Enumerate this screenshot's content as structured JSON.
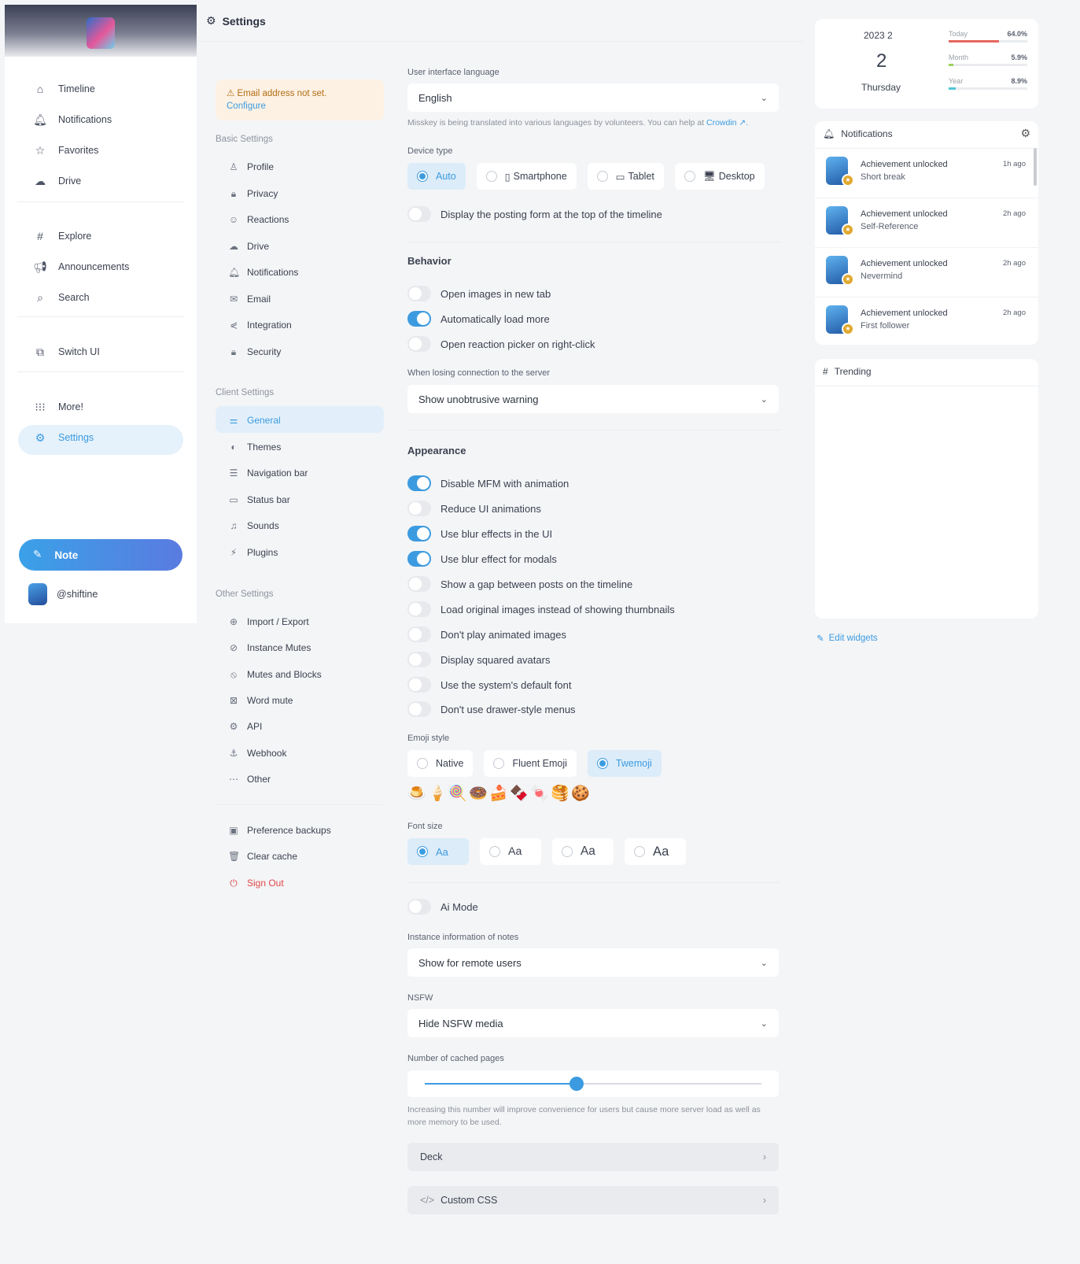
{
  "nav": {
    "items": [
      {
        "label": "Timeline",
        "icon": "home-icon",
        "glyph": "⌂"
      },
      {
        "label": "Notifications",
        "icon": "bell-icon",
        "glyph": "🔔︎"
      },
      {
        "label": "Favorites",
        "icon": "star-icon",
        "glyph": "☆"
      },
      {
        "label": "Drive",
        "icon": "cloud-icon",
        "glyph": "☁"
      },
      {
        "label": "Explore",
        "icon": "hash-icon",
        "glyph": "#"
      },
      {
        "label": "Announcements",
        "icon": "megaphone-icon",
        "glyph": "📢︎"
      },
      {
        "label": "Search",
        "icon": "search-icon",
        "glyph": "⌕"
      },
      {
        "label": "Switch UI",
        "icon": "switch-icon",
        "glyph": "⧉"
      },
      {
        "label": "More!",
        "icon": "grid-icon",
        "glyph": "⁝⁝⁝"
      },
      {
        "label": "Settings",
        "icon": "gear-icon",
        "glyph": "⚙"
      }
    ],
    "note_label": "Note",
    "account": "@shiftine"
  },
  "header": {
    "title": "Settings"
  },
  "menu": {
    "warning_text": "Email address not set.",
    "warning_link": "Configure",
    "basic_title": "Basic Settings",
    "basic": [
      "Profile",
      "Privacy",
      "Reactions",
      "Drive",
      "Notifications",
      "Email",
      "Integration",
      "Security"
    ],
    "client_title": "Client Settings",
    "client": [
      "General",
      "Themes",
      "Navigation bar",
      "Status bar",
      "Sounds",
      "Plugins"
    ],
    "other_title": "Other Settings",
    "other": [
      "Import / Export",
      "Instance Mutes",
      "Mutes and Blocks",
      "Word mute",
      "API",
      "Webhook",
      "Other"
    ],
    "extra": [
      "Preference backups",
      "Clear cache",
      "Sign Out"
    ]
  },
  "main": {
    "lang_label": "User interface language",
    "lang_value": "English",
    "lang_hint": "Misskey is being translated into various languages by volunteers. You can help at ",
    "lang_hint_link": "Crowdin",
    "device_label": "Device type",
    "device_options": [
      "Auto",
      "Smartphone",
      "Tablet",
      "Desktop"
    ],
    "device_selected": "Auto",
    "posting_form": "Display the posting form at the top of the timeline",
    "posting_form_on": false,
    "behavior_title": "Behavior",
    "behavior": [
      {
        "label": "Open images in new tab",
        "on": false
      },
      {
        "label": "Automatically load more",
        "on": true
      },
      {
        "label": "Open reaction picker on right-click",
        "on": false
      }
    ],
    "conn_label": "When losing connection to the server",
    "conn_value": "Show unobtrusive warning",
    "appearance_title": "Appearance",
    "appearance": [
      {
        "label": "Disable MFM with animation",
        "on": true
      },
      {
        "label": "Reduce UI animations",
        "on": false
      },
      {
        "label": "Use blur effects in the UI",
        "on": true
      },
      {
        "label": "Use blur effect for modals",
        "on": true
      },
      {
        "label": "Show a gap between posts on the timeline",
        "on": false
      },
      {
        "label": "Load original images instead of showing thumbnails",
        "on": false
      },
      {
        "label": "Don't play animated images",
        "on": false
      },
      {
        "label": "Display squared avatars",
        "on": false
      },
      {
        "label": "Use the system's default font",
        "on": false
      },
      {
        "label": "Don't use drawer-style menus",
        "on": false
      }
    ],
    "emoji_label": "Emoji style",
    "emoji_options": [
      "Native",
      "Fluent Emoji",
      "Twemoji"
    ],
    "emoji_selected": "Twemoji",
    "emoji_preview": [
      "🍮",
      "🍦",
      "🍭",
      "🍩",
      "🍰",
      "🍫",
      "🍬",
      "🥞",
      "🍪"
    ],
    "font_label": "Font size",
    "font_options": [
      "Aa",
      "Aa",
      "Aa",
      "Aa"
    ],
    "font_selected_index": 0,
    "ai_mode": "Ai Mode",
    "ai_mode_on": false,
    "instance_label": "Instance information of notes",
    "instance_value": "Show for remote users",
    "nsfw_label": "NSFW",
    "nsfw_value": "Hide NSFW media",
    "cache_label": "Number of cached pages",
    "cache_fraction": 0.45,
    "cache_hint": "Increasing this number will improve convenience for users but cause more server load as well as more memory to be used.",
    "deck_label": "Deck",
    "css_label": "Custom CSS"
  },
  "calendar": {
    "year_month": "2023  2",
    "day": "2",
    "weekday": "Thursday",
    "rows": [
      {
        "label": "Today",
        "pct": "64.0%",
        "value": 0.64,
        "color": "#e5675f"
      },
      {
        "label": "Month",
        "pct": "5.9%",
        "value": 0.059,
        "color": "#9bd35a"
      },
      {
        "label": "Year",
        "pct": "8.9%",
        "value": 0.089,
        "color": "#4fc7d6"
      }
    ]
  },
  "notifications": {
    "title": "Notifications",
    "items": [
      {
        "title": "Achievement unlocked",
        "body": "Short break",
        "time": "1h ago"
      },
      {
        "title": "Achievement unlocked",
        "body": "Self-Reference",
        "time": "2h ago"
      },
      {
        "title": "Achievement unlocked",
        "body": "Nevermind",
        "time": "2h ago"
      },
      {
        "title": "Achievement unlocked",
        "body": "First follower",
        "time": "2h ago"
      }
    ]
  },
  "trending": {
    "title": "Trending"
  },
  "edit_widgets": "Edit widgets",
  "colors": {
    "accent": "#3c9be0",
    "warning_bg": "#fdf1e4",
    "danger": "#e04747"
  }
}
